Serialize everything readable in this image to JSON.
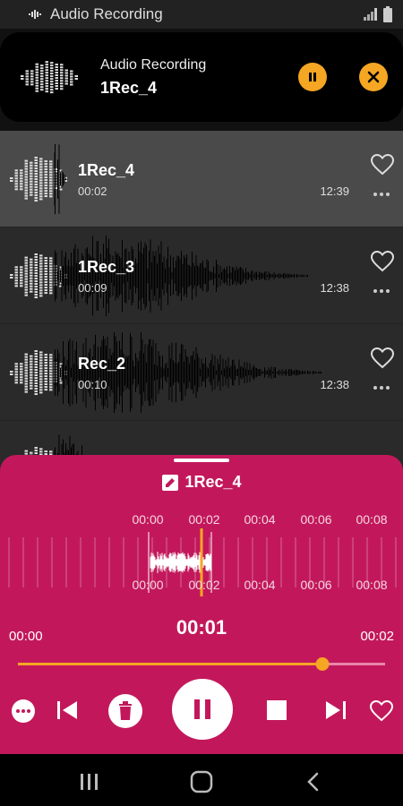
{
  "status_bar": {
    "title": "Audio Recording"
  },
  "top_card": {
    "title": "Audio Recording",
    "name": "1Rec_4"
  },
  "recordings": [
    {
      "name": "1Rec_4",
      "duration": "00:02",
      "time": "12:39",
      "selected": true
    },
    {
      "name": "1Rec_3",
      "duration": "00:09",
      "time": "12:38",
      "selected": false
    },
    {
      "name": "Rec_2",
      "duration": "00:10",
      "time": "12:38",
      "selected": false
    }
  ],
  "player": {
    "title": "1Rec_4",
    "timeline_ticks": [
      "00:00",
      "00:02",
      "00:04",
      "00:06",
      "00:08"
    ],
    "start_time": "00:00",
    "current_time": "00:01",
    "end_time": "00:02",
    "progress_fraction": 0.83
  },
  "colors": {
    "accent": "#f5a623",
    "panel": "#c2185b",
    "selected_row": "#4a4a4a"
  },
  "icons": [
    "pause-icon",
    "close-icon",
    "heart-icon",
    "more-icon",
    "prev-icon",
    "delete-icon",
    "stop-icon",
    "next-icon",
    "recents-icon",
    "home-icon",
    "back-icon"
  ]
}
